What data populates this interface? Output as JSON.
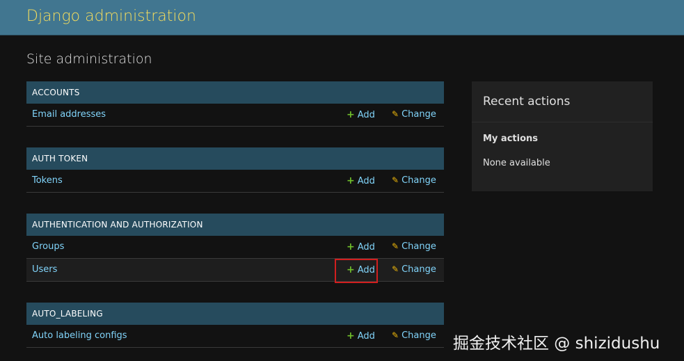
{
  "header": {
    "site_title": "Django administration"
  },
  "content": {
    "title": "Site administration"
  },
  "modules": [
    {
      "caption": "ACCOUNTS",
      "models": [
        {
          "name": "Email addresses",
          "add_label": "Add",
          "change_label": "Change"
        }
      ]
    },
    {
      "caption": "AUTH TOKEN",
      "models": [
        {
          "name": "Tokens",
          "add_label": "Add",
          "change_label": "Change"
        }
      ]
    },
    {
      "caption": "AUTHENTICATION AND AUTHORIZATION",
      "models": [
        {
          "name": "Groups",
          "add_label": "Add",
          "change_label": "Change"
        },
        {
          "name": "Users",
          "add_label": "Add",
          "change_label": "Change"
        }
      ]
    },
    {
      "caption": "AUTO_LABELING",
      "models": [
        {
          "name": "Auto labeling configs",
          "add_label": "Add",
          "change_label": "Change"
        }
      ]
    }
  ],
  "recent_actions": {
    "title": "Recent actions",
    "my_actions_label": "My actions",
    "empty_text": "None available"
  },
  "icons": {
    "add_symbol": "+",
    "change_symbol": "✎"
  },
  "watermark": {
    "text": "掘金技术社区 @ shizidushu"
  },
  "colors": {
    "header_bg": "#417690",
    "branding": "#f5dd5d",
    "caption_bg": "#264b5d",
    "link": "#81d4fa",
    "add_icon": "#70bf2b",
    "change_icon": "#efb80b",
    "highlight": "#d11f1f"
  }
}
